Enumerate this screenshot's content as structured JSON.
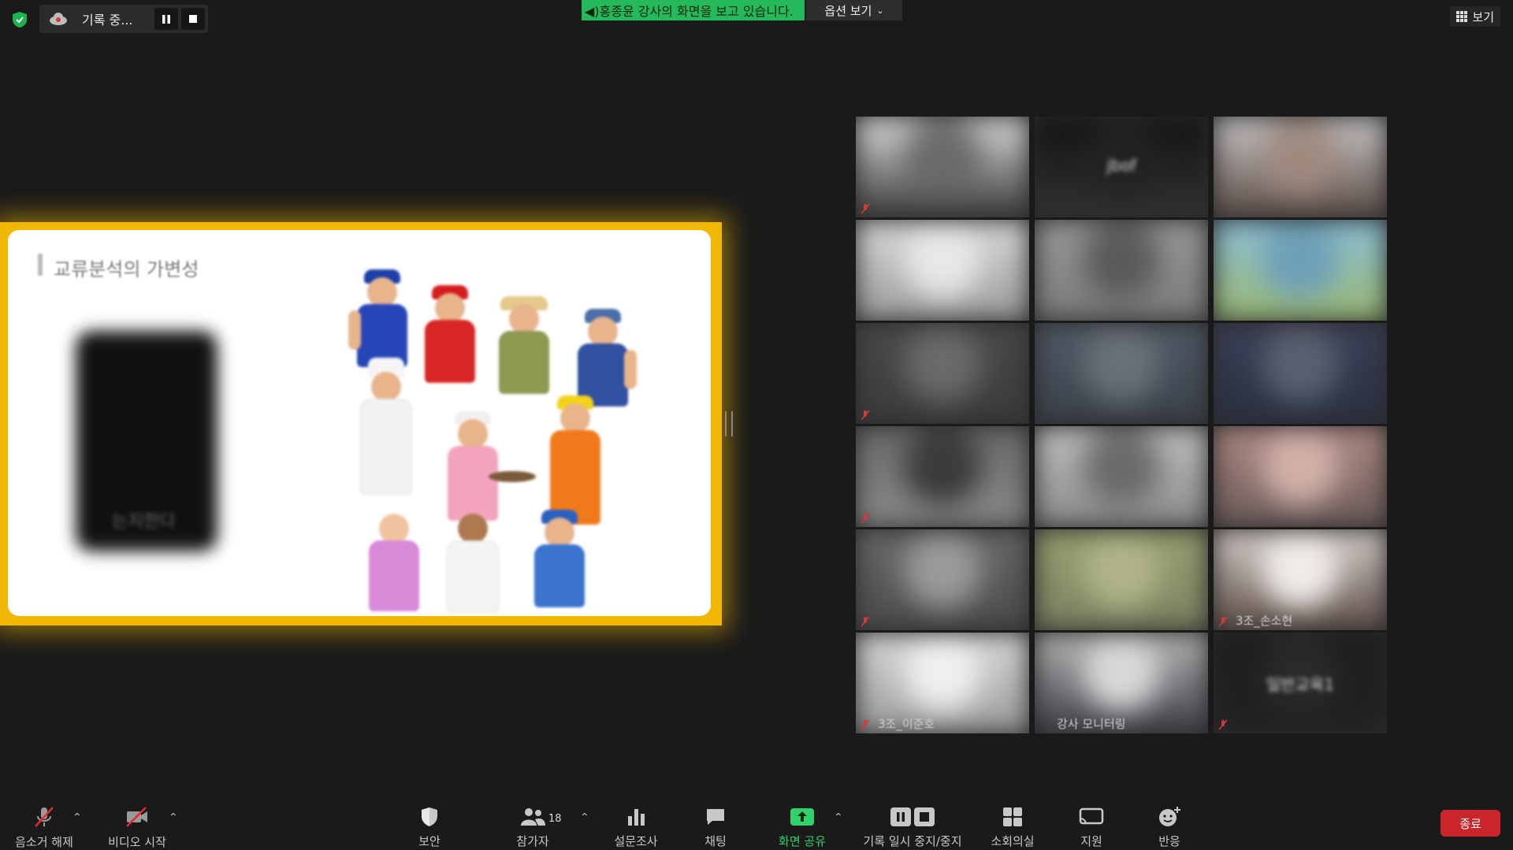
{
  "top_bar": {
    "recording_label": "기록 중...",
    "share_banner": "◀)홍종윤 강사의 화면을 보고 있습니다.",
    "view_options": "옵션 보기",
    "view_button": "보기"
  },
  "slide": {
    "title": "교류분석의 가변성",
    "blurred_text": "는지한다"
  },
  "participants": [
    {
      "name": "",
      "muted": true
    },
    {
      "name": "",
      "muted": false,
      "center_text": "jbof"
    },
    {
      "name": "",
      "muted": false
    },
    {
      "name": "",
      "muted": false
    },
    {
      "name": "",
      "muted": false
    },
    {
      "name": "",
      "muted": false
    },
    {
      "name": "",
      "muted": true
    },
    {
      "name": "",
      "muted": false
    },
    {
      "name": "",
      "muted": false
    },
    {
      "name": "",
      "muted": true
    },
    {
      "name": "",
      "muted": false
    },
    {
      "name": "",
      "muted": false
    },
    {
      "name": "",
      "muted": true
    },
    {
      "name": "",
      "muted": false
    },
    {
      "name": "3조_손소현",
      "muted": true
    },
    {
      "name": "3조_이준호",
      "muted": true
    },
    {
      "name": "강사 모니터링",
      "muted": false
    },
    {
      "name": "",
      "muted": true,
      "center_text": "일반교육1"
    }
  ],
  "toolbar": {
    "mute_label": "음소거 해제",
    "video_label": "비디오 시작",
    "security_label": "보안",
    "participants_label": "참가자",
    "participants_count": "18",
    "polls_label": "설문조사",
    "chat_label": "채팅",
    "share_label": "화면 공유",
    "record_label": "기록 일시 중지/중지",
    "breakout_label": "소회의실",
    "support_label": "지원",
    "reactions_label": "반응",
    "end_label": "종료"
  },
  "colors": {
    "background": "#1a1a1a",
    "share_banner": "#24b95a",
    "share_highlight": "#f2b705",
    "end_button": "#c9252a",
    "active_tool": "#2fd36a"
  }
}
